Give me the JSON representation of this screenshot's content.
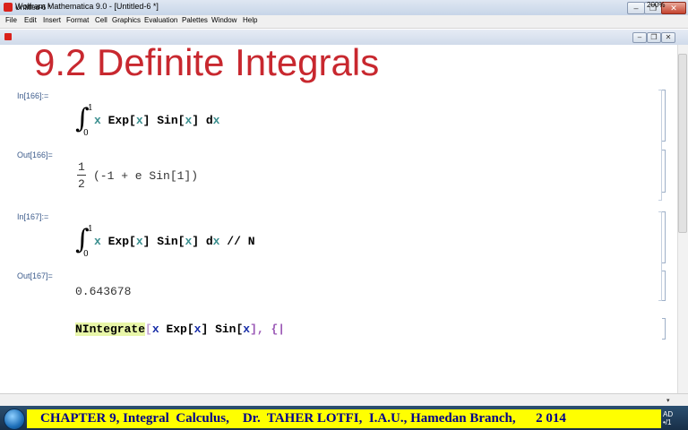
{
  "window": {
    "title": "Wolfram Mathematica 9.0 - [Untitled-6 *]",
    "document_title": "Untitled-6 *",
    "controls": {
      "minimize": "–",
      "restore": "❐",
      "close": "✕"
    }
  },
  "menu": [
    "File",
    "Edit",
    "Insert",
    "Format",
    "Cell",
    "Graphics",
    "Evaluation",
    "Palettes",
    "Window",
    "Help"
  ],
  "notebook": {
    "section_title": "9.2 Definite Integrals",
    "cells": [
      {
        "label": "In[166]:=",
        "upper": "1",
        "lower": "0",
        "integrand": [
          "x",
          " Exp[",
          "x",
          "] Sin[",
          "x",
          "] d",
          "x"
        ]
      },
      {
        "label": "Out[166]=",
        "numerator": "1",
        "denominator": "2",
        "expr": "(-1 + e Sin[1])"
      },
      {
        "label": "In[167]:=",
        "upper": "1",
        "lower": "0",
        "integrand": [
          "x",
          " Exp[",
          "x",
          "] Sin[",
          "x",
          "] d",
          "x",
          " // N"
        ]
      },
      {
        "label": "Out[167]=",
        "value": "0.643678"
      },
      {
        "input_hl": "NIntegrate",
        "input_rest_parts": [
          "[",
          "x",
          " Exp[",
          "x",
          "] Sin[",
          "x",
          "], {|"
        ]
      }
    ]
  },
  "statusbar": {
    "zoom": "200%"
  },
  "banner": {
    "text": "CHAPTER 9, Integral  Calculus,    Dr.  TAHER LOTFI,  I.A.U., Hamedan Branch,      2 014"
  },
  "taskbar": {
    "clock_line1": "AD",
    "clock_line2": "•/1"
  }
}
